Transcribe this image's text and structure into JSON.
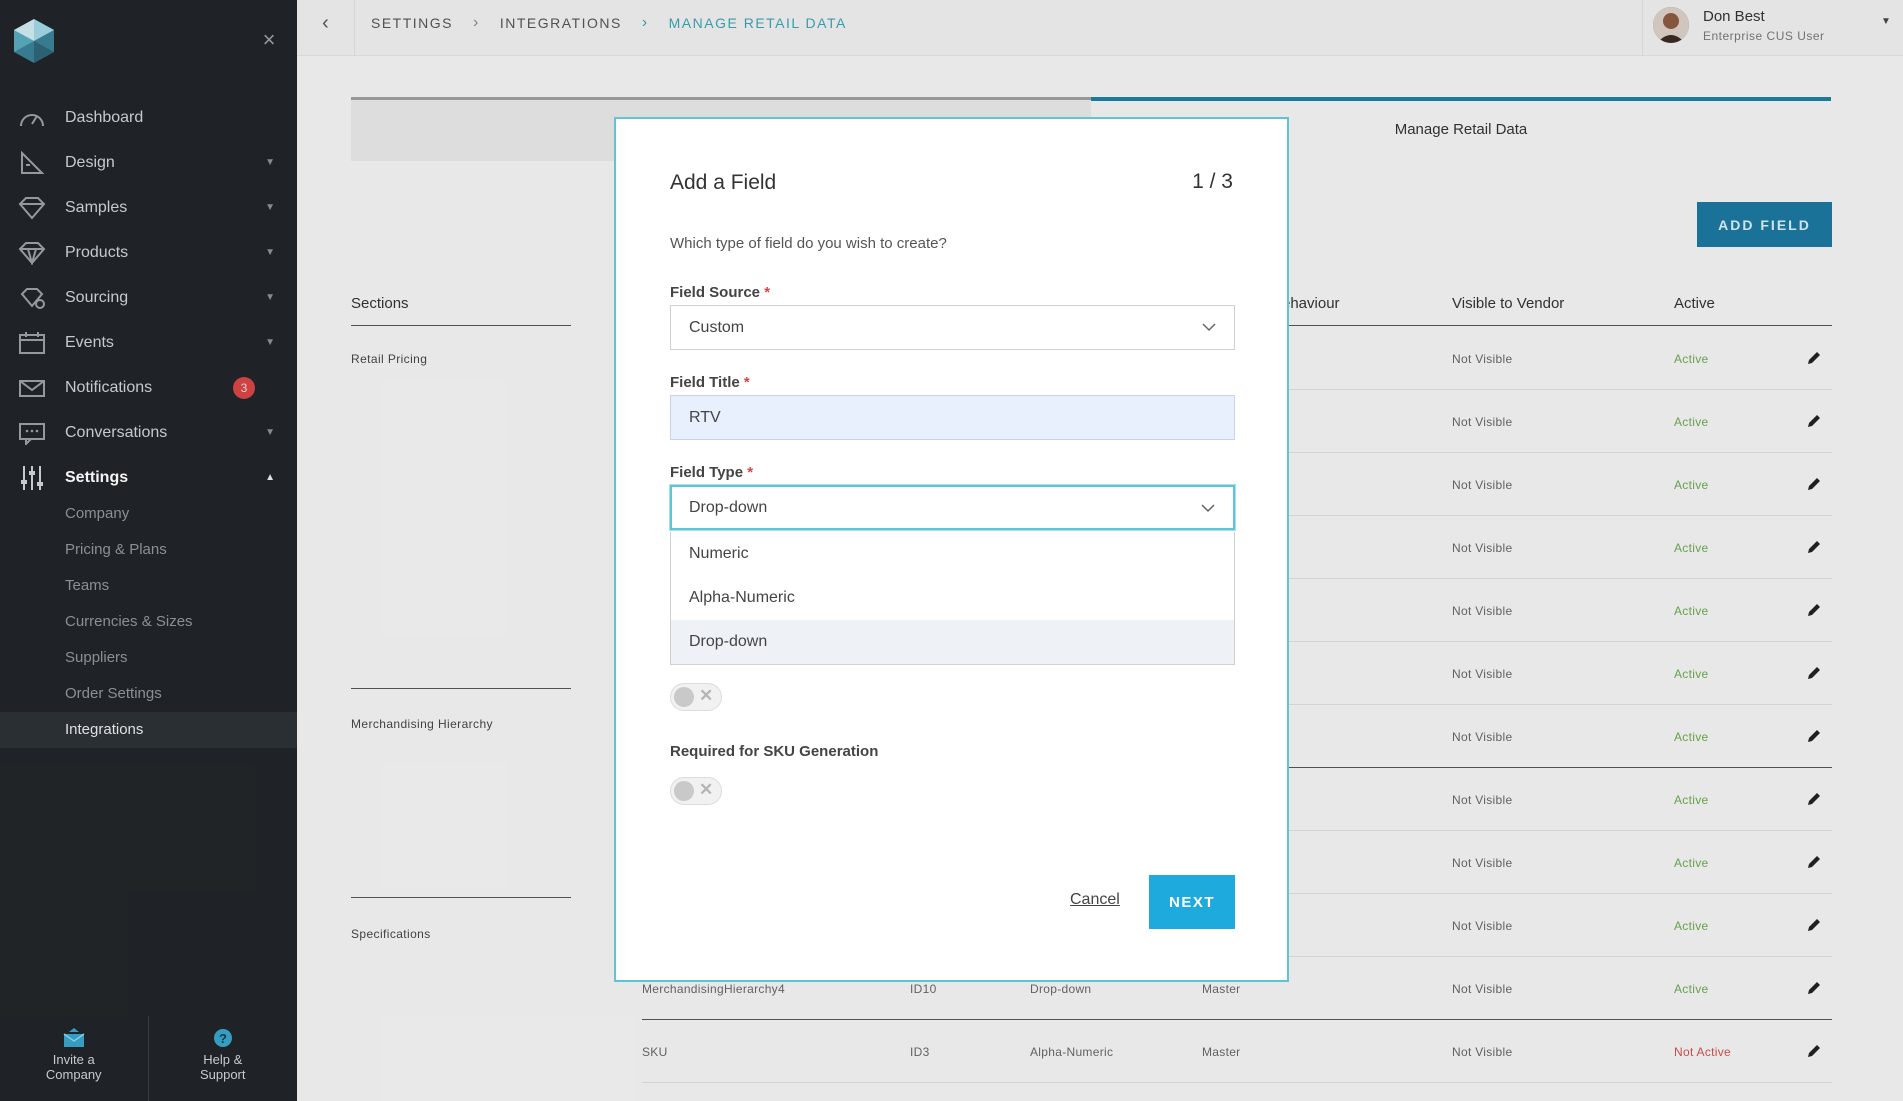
{
  "sidebar": {
    "nav": [
      {
        "label": "Dashboard",
        "icon": "dashboard-icon",
        "caret": false
      },
      {
        "label": "Design",
        "icon": "design-icon",
        "caret": true
      },
      {
        "label": "Samples",
        "icon": "samples-icon",
        "caret": true
      },
      {
        "label": "Products",
        "icon": "products-icon",
        "caret": true
      },
      {
        "label": "Sourcing",
        "icon": "sourcing-icon",
        "caret": true
      },
      {
        "label": "Events",
        "icon": "events-icon",
        "caret": true
      },
      {
        "label": "Notifications",
        "icon": "envelope-icon",
        "badge": "3"
      },
      {
        "label": "Conversations",
        "icon": "conversations-icon",
        "caret": true
      },
      {
        "label": "Settings",
        "icon": "settings-icon",
        "caret_up": true
      }
    ],
    "sub": [
      "Company",
      "Pricing & Plans",
      "Teams",
      "Currencies & Sizes",
      "Suppliers",
      "Order Settings",
      "Integrations"
    ],
    "bottom": {
      "invite": "Invite a Company",
      "help": "Help & Support"
    }
  },
  "header": {
    "crumbs": [
      "SETTINGS",
      "INTEGRATIONS",
      "MANAGE RETAIL DATA"
    ],
    "user_name": "Don Best",
    "user_role": "Enterprise CUS User"
  },
  "page": {
    "tab_right": "Manage Retail Data",
    "add_field": "ADD FIELD",
    "columns": {
      "sections": "Sections",
      "behaviour": "ehaviour",
      "visible": "Visible to Vendor",
      "active": "Active"
    },
    "sections": [
      "Retail Pricing",
      "Merchandising Hierarchy",
      "Specifications"
    ],
    "rows": [
      {
        "visible": "Not Visible",
        "active": "Active"
      },
      {
        "visible": "Not Visible",
        "active": "Active"
      },
      {
        "visible": "Not Visible",
        "active": "Active"
      },
      {
        "visible": "Not Visible",
        "active": "Active"
      },
      {
        "visible": "Not Visible",
        "active": "Active"
      },
      {
        "visible": "Not Visible",
        "active": "Active"
      },
      {
        "visible": "Not Visible",
        "active": "Active"
      },
      {
        "visible": "Not Visible",
        "active": "Active"
      },
      {
        "visible": "Not Visible",
        "active": "Active"
      },
      {
        "visible": "Not Visible",
        "active": "Active"
      },
      {
        "name": "MerchandisingHierarchy4",
        "id": "ID10",
        "type": "Drop-down",
        "behaviour": "Master",
        "visible": "Not Visible",
        "active": "Active"
      },
      {
        "name": "SKU",
        "id": "ID3",
        "type": "Alpha-Numeric",
        "behaviour": "Master",
        "visible": "Not Visible",
        "active": "Not Active"
      }
    ]
  },
  "modal": {
    "title": "Add a Field",
    "step": "1 / 3",
    "question": "Which type of field do you wish to create?",
    "source_label": "Field Source",
    "source_value": "Custom",
    "title_label": "Field Title",
    "title_value": "RTV",
    "type_label": "Field Type",
    "type_value": "Drop-down",
    "type_options": [
      "Numeric",
      "Alpha-Numeric",
      "Drop-down"
    ],
    "sku_label": "Required for SKU Generation",
    "cancel": "Cancel",
    "next": "NEXT",
    "req": "*"
  }
}
